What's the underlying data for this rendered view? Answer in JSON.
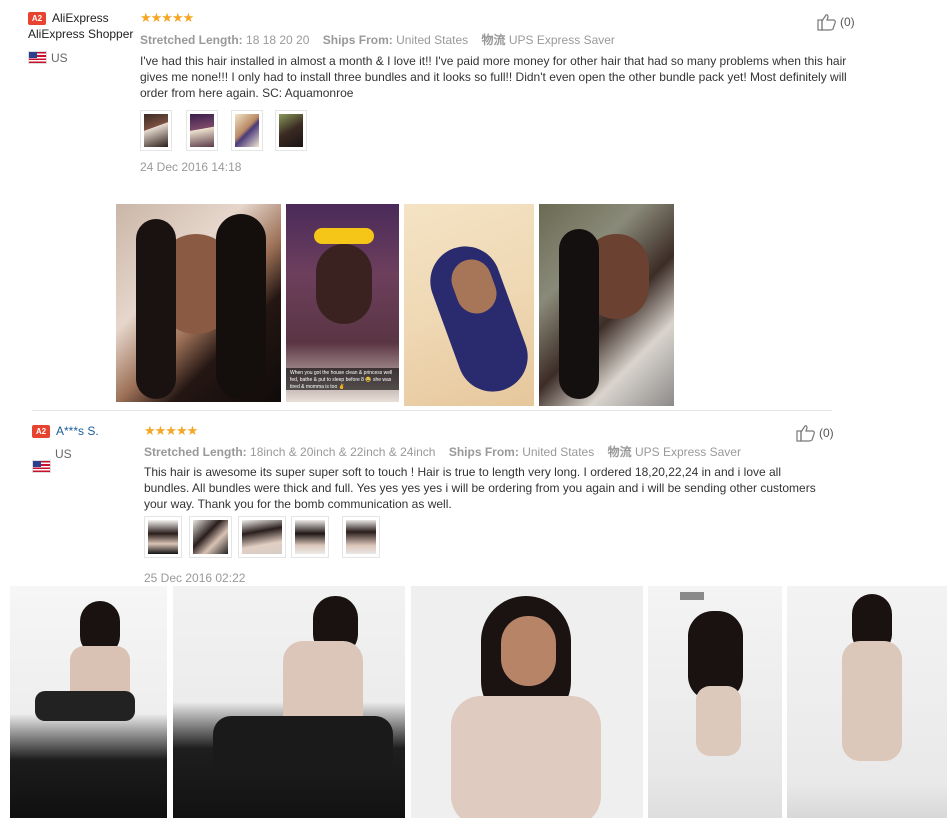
{
  "review1": {
    "badge": "A2",
    "name": "AliExpress Shopper",
    "country": "US",
    "stars": "★★★★★",
    "length_label": "Stretched Length:",
    "length_value": "18 18 20 20",
    "ships_label": "Ships From:",
    "ships_value": "United States",
    "logistics_label": "物流",
    "logistics_value": "UPS Express Saver",
    "text": "I've had this hair installed in almost a month & I love it!! I've paid more money for other hair that had so many problems when this hair gives me none!!! I only had to install three bundles and it looks so full!! Didn't even open the other bundle pack yet! Most definitely will order from here again. SC: Aquamonroe",
    "date": "24 Dec 2016 14:18",
    "helpful": "(0)",
    "photo_caption": "When you got the house clean & princess well fed, bathe & put to sleep before 8 😂 she was tired & momma is too ✌"
  },
  "review2": {
    "badge": "A2",
    "name": "A***s S.",
    "country": "US",
    "stars": "★★★★★",
    "length_label": "Stretched Length:",
    "length_value": "18inch & 20inch & 22inch & 24inch",
    "ships_label": "Ships From:",
    "ships_value": "United States",
    "logistics_label": "物流",
    "logistics_value": "UPS Express Saver",
    "text": "This hair is awesome its super super soft to touch ! Hair is true to length very long. I ordered 18,20,22,24 in and i love all bundles. All bundles were thick and full. Yes yes yes yes i will be ordering from you again and i will be sending other customers your way. Thank you for the bomb communication as well.",
    "date": "25 Dec 2016 02:22",
    "helpful": "(0)"
  },
  "colors": {
    "badge": "#e8432e",
    "star": "#f5a623",
    "link_name": "#1a5c9a",
    "muted": "#999999"
  }
}
